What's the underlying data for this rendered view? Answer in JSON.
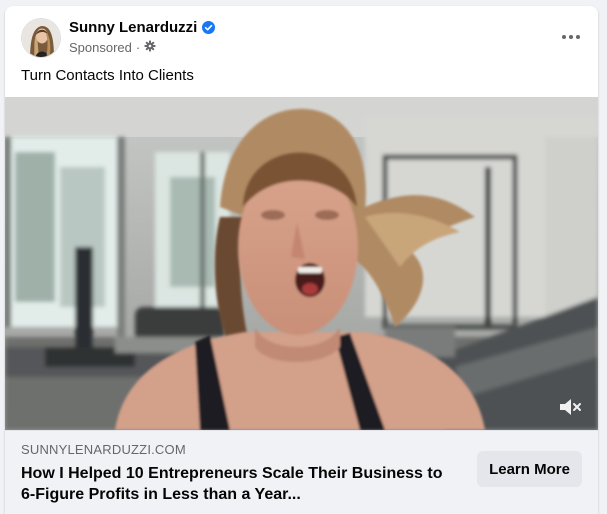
{
  "post": {
    "author": "Sunny Lenarduzzi",
    "sponsored_label": "Sponsored",
    "meta_separator": "·",
    "caption": "Turn Contacts Into Clients",
    "media": {
      "type": "video",
      "muted": true
    }
  },
  "link_preview": {
    "domain": "SUNNYLENARDUZZI.COM",
    "headline": "How I Helped 10 Entrepreneurs Scale Their Business to 6-Figure Profits in Less than a Year...",
    "cta_label": "Learn More"
  },
  "colors": {
    "verified_badge": "#1877f2",
    "secondary_text": "#65676b",
    "link_bar_bg": "#f0f2f5",
    "cta_bg": "#e4e6eb"
  },
  "icons": {
    "verified": "verified-badge-icon",
    "audience": "gear-icon",
    "more": "more-options-icon",
    "mute": "muted-speaker-icon"
  }
}
